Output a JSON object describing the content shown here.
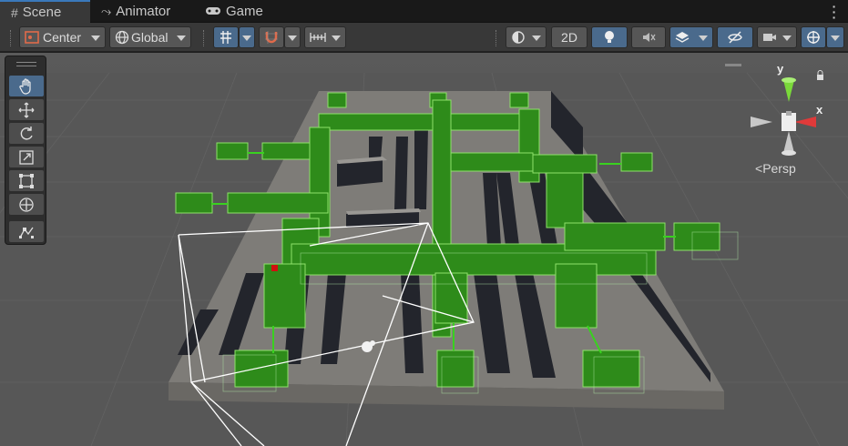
{
  "tabs": [
    {
      "label": "Scene",
      "icon": "grid-icon",
      "active": true
    },
    {
      "label": "Animator",
      "icon": "animator-icon",
      "active": false
    },
    {
      "label": "Game",
      "icon": "gamepad-icon",
      "active": false
    }
  ],
  "toolbar": {
    "pivot_label": "Center",
    "space_label": "Global",
    "mode_2d_label": "2D"
  },
  "tools": [
    "hand-tool",
    "move-tool",
    "rotate-tool",
    "scale-tool",
    "rect-tool",
    "transform-tool",
    "custom-editor-tool"
  ],
  "gizmo": {
    "y_label": "y",
    "x_label": "x",
    "projection_label": "Persp"
  },
  "colors": {
    "selection_green": "#2e8b1a",
    "accent_blue": "#3a79bb",
    "gizmo_y": "#7ad93a",
    "gizmo_x": "#e03a3a"
  }
}
